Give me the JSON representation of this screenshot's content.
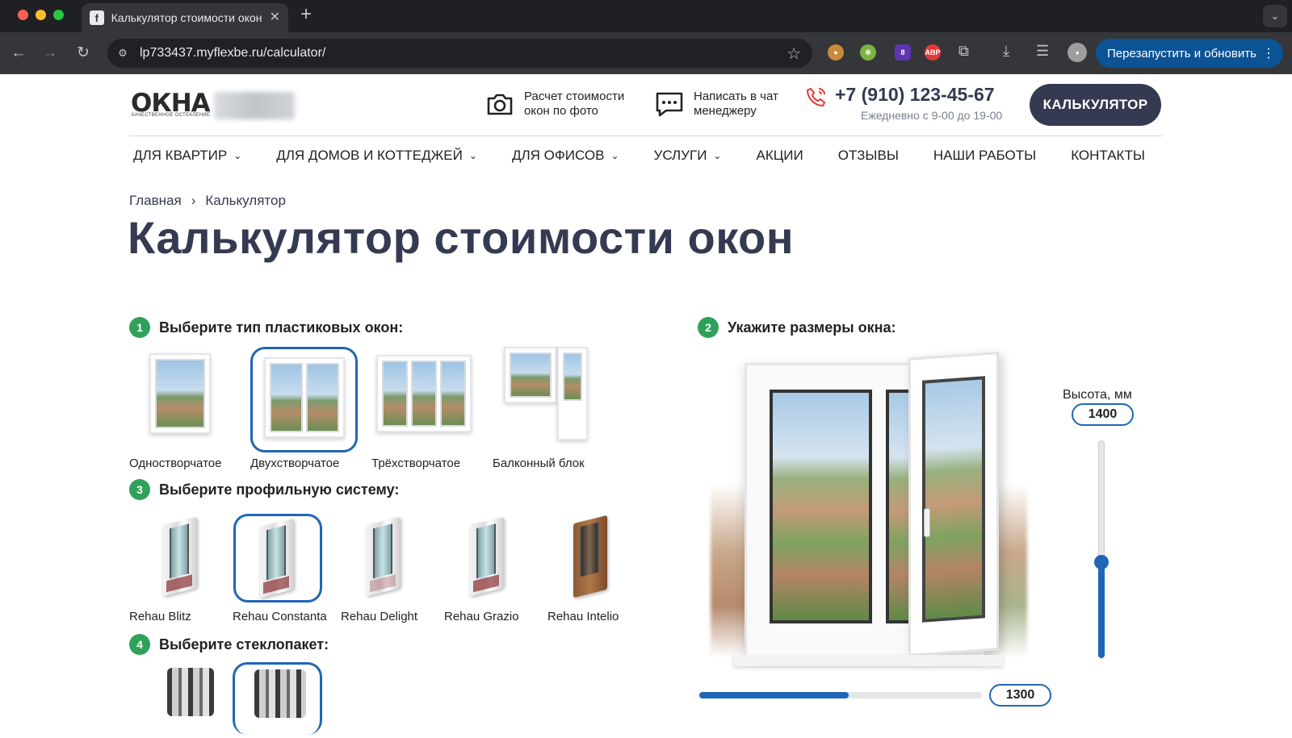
{
  "browser": {
    "tab_title": "Калькулятор стоимости окон",
    "tab_favicon": "f",
    "url": "lp733437.myflexbe.ru/calculator/",
    "relaunch_label": "Перезапустить и обновить",
    "extension_badge": "8",
    "abp_label": "ABP"
  },
  "header": {
    "logo_text": "ОКНА",
    "logo_subtitle": "КАЧЕСТВЕННОЕ ОСТЕКЛЕНИЕ",
    "photo_calc_line1": "Расчет стоимости",
    "photo_calc_line2": "окон по фото",
    "chat_line1": "Написать в чат",
    "chat_line2": "менеджеру",
    "phone": "+7 (910) 123-45-67",
    "hours": "Ежедневно с 9-00 до 19-00",
    "calc_button": "КАЛЬКУЛЯТОР"
  },
  "menu": [
    {
      "label": "ДЛЯ КВАРТИР",
      "dropdown": true
    },
    {
      "label": "ДЛЯ ДОМОВ И КОТТЕДЖЕЙ",
      "dropdown": true
    },
    {
      "label": "ДЛЯ ОФИСОВ",
      "dropdown": true
    },
    {
      "label": "УСЛУГИ",
      "dropdown": true
    },
    {
      "label": "АКЦИИ",
      "dropdown": false
    },
    {
      "label": "ОТЗЫВЫ",
      "dropdown": false
    },
    {
      "label": "НАШИ РАБОТЫ",
      "dropdown": false
    },
    {
      "label": "КОНТАКТЫ",
      "dropdown": false
    }
  ],
  "breadcrumb": {
    "home": "Главная",
    "separator": "›",
    "current": "Калькулятор"
  },
  "page_title": "Калькулятор стоимости окон",
  "steps": {
    "s1": {
      "num": "1",
      "title": "Выберите тип пластиковых окон:"
    },
    "s2": {
      "num": "2",
      "title": "Укажите размеры окна:"
    },
    "s3": {
      "num": "3",
      "title": "Выберите профильную систему:"
    },
    "s4": {
      "num": "4",
      "title": "Выберите стеклопакет:"
    }
  },
  "window_types": [
    {
      "label": "Одностворчатое",
      "selected": false
    },
    {
      "label": "Двухстворчатое",
      "selected": true
    },
    {
      "label": "Трёхстворчатое",
      "selected": false
    },
    {
      "label": "Балконный блок",
      "selected": false
    }
  ],
  "profiles": [
    {
      "label": "Rehau Blitz",
      "selected": false
    },
    {
      "label": "Rehau Constanta",
      "selected": true
    },
    {
      "label": "Rehau Delight",
      "selected": false
    },
    {
      "label": "Rehau Grazio",
      "selected": false
    },
    {
      "label": "Rehau Intelio",
      "selected": false
    }
  ],
  "dimensions": {
    "height_label": "Высота, мм",
    "height_value": "1400",
    "width_value": "1300"
  },
  "colors": {
    "accent": "#1f66b5",
    "step_badge": "#2fa15a",
    "heading": "#353a52"
  }
}
